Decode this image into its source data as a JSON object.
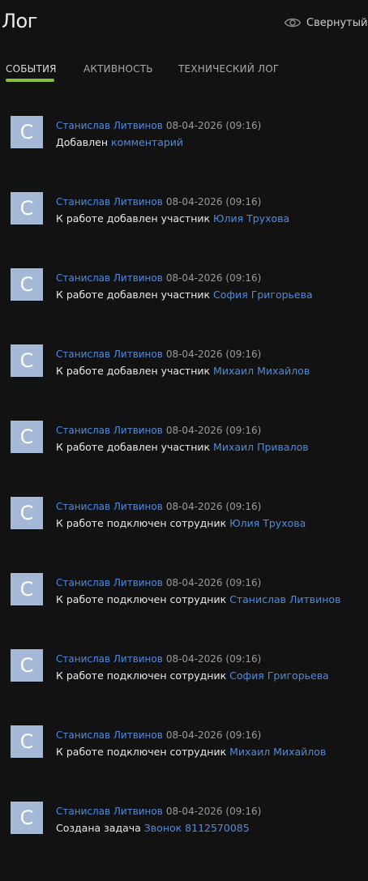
{
  "header": {
    "title": "Лог",
    "view_mode_label": "Свернутый"
  },
  "tabs": [
    {
      "label": "СОБЫТИЯ",
      "active": true
    },
    {
      "label": "АКТИВНОСТЬ",
      "active": false
    },
    {
      "label": "ТЕХНИЧЕСКИЙ ЛОГ",
      "active": false
    }
  ],
  "colors": {
    "background": "#121212",
    "accent_tab": "#8bbf3a",
    "link": "#4f8be0",
    "avatar_bg": "#a5b8d6"
  },
  "log": [
    {
      "avatar": "C",
      "author": "Станислав Литвинов",
      "time": "08-04-2026 (09:16)",
      "text": "Добавлен",
      "link": "комментарий"
    },
    {
      "avatar": "C",
      "author": "Станислав Литвинов",
      "time": "08-04-2026 (09:16)",
      "text": "К работе добавлен участник",
      "link": "Юлия Трухова"
    },
    {
      "avatar": "C",
      "author": "Станислав Литвинов",
      "time": "08-04-2026 (09:16)",
      "text": "К работе добавлен участник",
      "link": "София Григорьева"
    },
    {
      "avatar": "C",
      "author": "Станислав Литвинов",
      "time": "08-04-2026 (09:16)",
      "text": "К работе добавлен участник",
      "link": "Михаил Михайлов"
    },
    {
      "avatar": "C",
      "author": "Станислав Литвинов",
      "time": "08-04-2026 (09:16)",
      "text": "К работе добавлен участник",
      "link": "Михаил Привалов"
    },
    {
      "avatar": "C",
      "author": "Станислав Литвинов",
      "time": "08-04-2026 (09:16)",
      "text": "К работе подключен сотрудник",
      "link": "Юлия Трухова"
    },
    {
      "avatar": "C",
      "author": "Станислав Литвинов",
      "time": "08-04-2026 (09:16)",
      "text": "К работе подключен сотрудник",
      "link": "Станислав Литвинов"
    },
    {
      "avatar": "C",
      "author": "Станислав Литвинов",
      "time": "08-04-2026 (09:16)",
      "text": "К работе подключен сотрудник",
      "link": "София Григорьева"
    },
    {
      "avatar": "C",
      "author": "Станислав Литвинов",
      "time": "08-04-2026 (09:16)",
      "text": "К работе подключен сотрудник",
      "link": "Михаил Михайлов"
    },
    {
      "avatar": "C",
      "author": "Станислав Литвинов",
      "time": "08-04-2026 (09:16)",
      "text": "Создана задача",
      "link": "Звонок 8112570085"
    }
  ]
}
